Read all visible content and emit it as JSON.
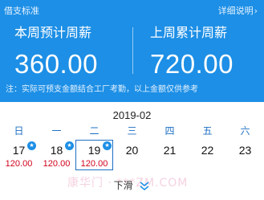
{
  "header": {
    "top_left": "借支标准",
    "top_right": "详细说明",
    "this_week": {
      "label": "本周预计周薪",
      "value": "360.00"
    },
    "last_week": {
      "label": "上周累计周薪",
      "value": "720.00"
    },
    "note": "注：实际可预支金额结合工厂考勤，以上金额仅供参考",
    "color": "#1d8fe6"
  },
  "calendar": {
    "month": "2019-02",
    "weekdays": [
      "日",
      "一",
      "二",
      "三",
      "四",
      "五",
      "六"
    ],
    "days": [
      {
        "num": "17",
        "amount": "120.00",
        "badge": "★"
      },
      {
        "num": "18",
        "amount": "120.00",
        "badge": "★"
      },
      {
        "num": "19",
        "amount": "120.00",
        "badge": "★",
        "selected": true
      },
      {
        "num": "20"
      },
      {
        "num": "21"
      },
      {
        "num": "22"
      },
      {
        "num": "23"
      }
    ],
    "weekday_color": "#1d6fc4",
    "amount_color": "#d0021b"
  },
  "footer": {
    "pull_label": "下滑",
    "watermark": "康华门 · ***ZM.COM"
  }
}
